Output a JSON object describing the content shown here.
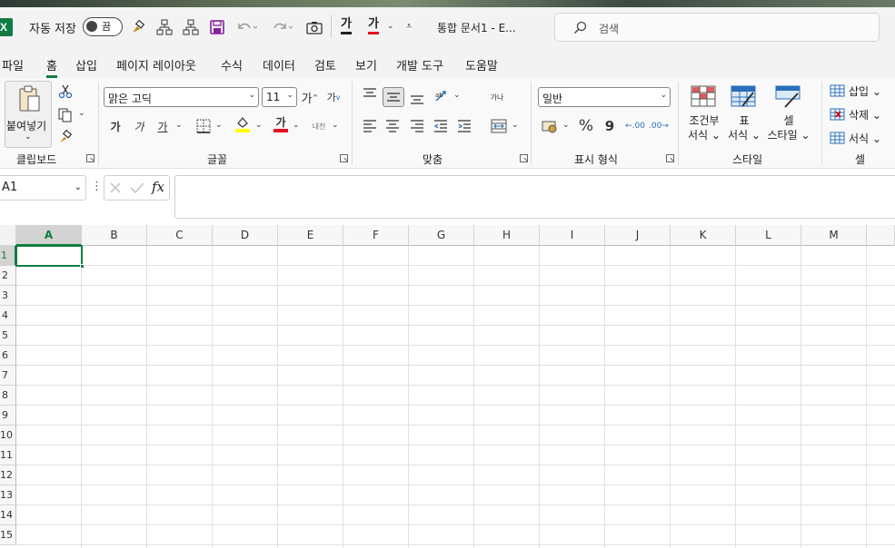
{
  "titlebar": {
    "app_icon_letter": "X",
    "autosave_label": "자동 저장",
    "autosave_state": "끔",
    "font_color_a": "가",
    "font_color_b": "가",
    "doc_title": "통합 문서1  -  E...",
    "search_placeholder": "검색"
  },
  "menu": {
    "tabs": [
      "파일",
      "홈",
      "삽입",
      "페이지 레이아웃",
      "수식",
      "데이터",
      "검토",
      "보기",
      "개발 도구",
      "도움말"
    ],
    "active_tab": "홈"
  },
  "ribbon": {
    "clipboard": {
      "paste_label": "붙여넣기",
      "group_label": "클립보드"
    },
    "font": {
      "font_name": "맑은 고딕",
      "font_size": "11",
      "grow": "가",
      "shrink": "가",
      "bold": "가",
      "italic": "가",
      "underline": "가",
      "font_color": "가",
      "phonetic": "내천",
      "group_label": "글꼴"
    },
    "alignment": {
      "wrap": "가나",
      "group_label": "맞춤"
    },
    "number": {
      "format": "일반",
      "percent": "%",
      "comma": "9",
      "inc_decimal": ".00",
      "dec_decimal": ".00",
      "group_label": "표시 형식"
    },
    "styles": {
      "conditional_l1": "조건부",
      "conditional_l2": "서식",
      "table_l1": "표",
      "table_l2": "서식",
      "cell_l1": "셀",
      "cell_l2": "스타일",
      "group_label": "스타일"
    },
    "cells": {
      "insert": "삽입",
      "delete": "삭제",
      "format": "서식",
      "group_label": "셀"
    }
  },
  "formula_bar": {
    "name_box": "A1",
    "fx": "fx",
    "value": ""
  },
  "sheet": {
    "columns": [
      "A",
      "B",
      "C",
      "D",
      "E",
      "F",
      "G",
      "H",
      "I",
      "J",
      "K",
      "L",
      "M"
    ],
    "rows": [
      "1",
      "2",
      "3",
      "4",
      "5",
      "6",
      "7",
      "8",
      "9",
      "10",
      "11",
      "12",
      "13",
      "14",
      "15"
    ],
    "active_cell": "A1"
  },
  "colors": {
    "accent": "#107c41",
    "font_color_red": "#e81123",
    "highlight_yellow": "#ffff00"
  }
}
